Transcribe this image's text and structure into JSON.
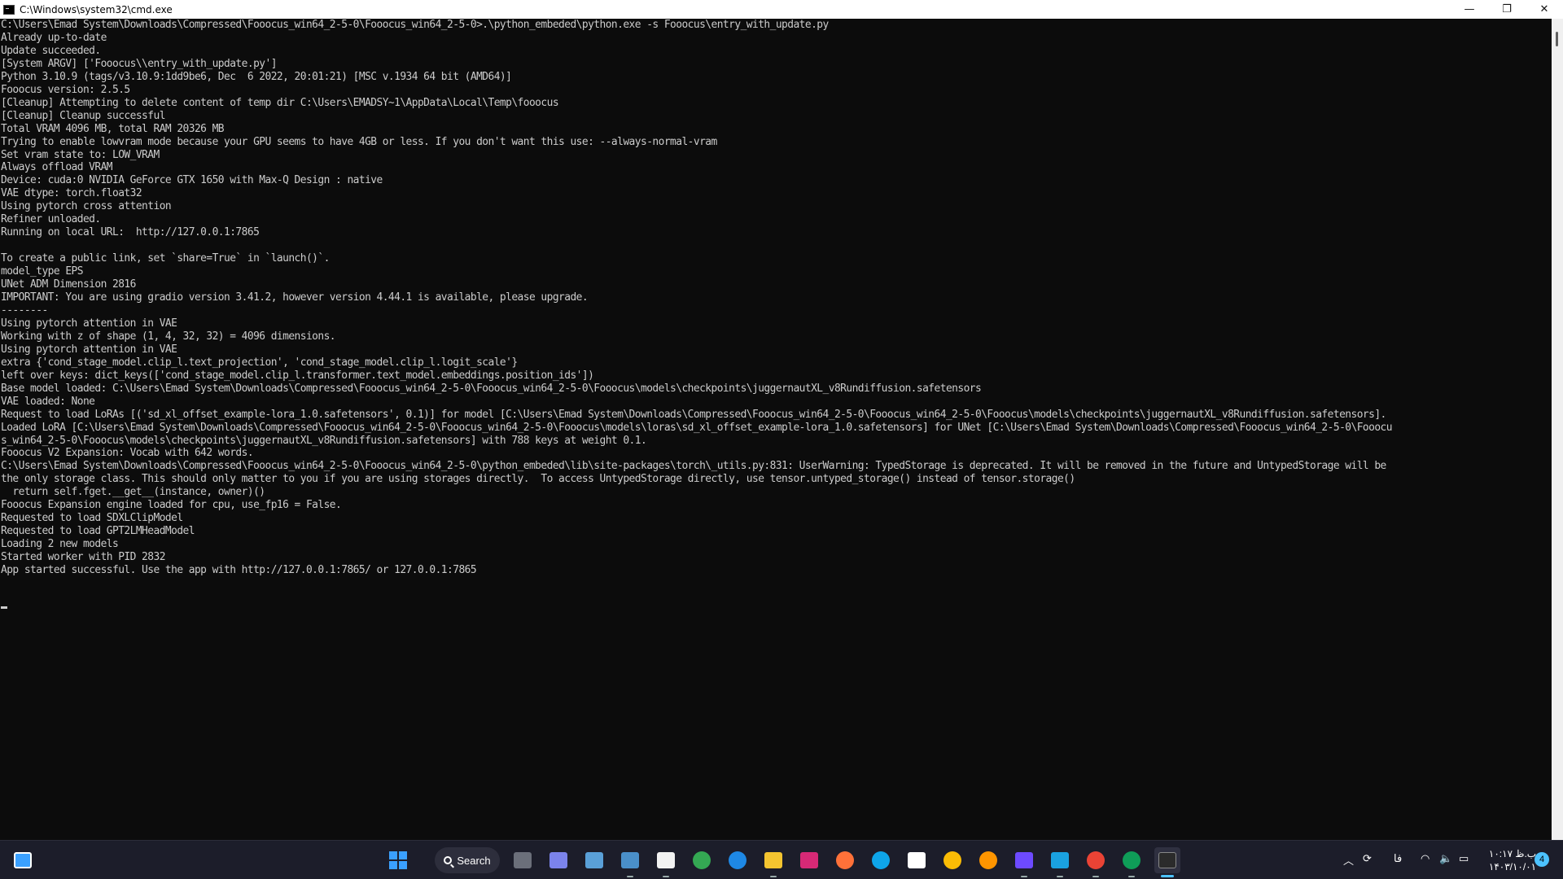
{
  "window": {
    "title": "C:\\Windows\\system32\\cmd.exe",
    "minimize": "—",
    "maximize": "❐",
    "close": "✕"
  },
  "console": {
    "lines": [
      "C:\\Users\\Emad System\\Downloads\\Compressed\\Fooocus_win64_2-5-0\\Fooocus_win64_2-5-0>.\\python_embeded\\python.exe -s Fooocus\\entry_with_update.py",
      "Already up-to-date",
      "Update succeeded.",
      "[System ARGV] ['Fooocus\\\\entry_with_update.py']",
      "Python 3.10.9 (tags/v3.10.9:1dd9be6, Dec  6 2022, 20:01:21) [MSC v.1934 64 bit (AMD64)]",
      "Fooocus version: 2.5.5",
      "[Cleanup] Attempting to delete content of temp dir C:\\Users\\EMADSY~1\\AppData\\Local\\Temp\\fooocus",
      "[Cleanup] Cleanup successful",
      "Total VRAM 4096 MB, total RAM 20326 MB",
      "Trying to enable lowvram mode because your GPU seems to have 4GB or less. If you don't want this use: --always-normal-vram",
      "Set vram state to: LOW_VRAM",
      "Always offload VRAM",
      "Device: cuda:0 NVIDIA GeForce GTX 1650 with Max-Q Design : native",
      "VAE dtype: torch.float32",
      "Using pytorch cross attention",
      "Refiner unloaded.",
      "Running on local URL:  http://127.0.0.1:7865",
      "",
      "To create a public link, set `share=True` in `launch()`.",
      "model_type EPS",
      "UNet ADM Dimension 2816",
      "IMPORTANT: You are using gradio version 3.41.2, however version 4.44.1 is available, please upgrade.",
      "--------",
      "Using pytorch attention in VAE",
      "Working with z of shape (1, 4, 32, 32) = 4096 dimensions.",
      "Using pytorch attention in VAE",
      "extra {'cond_stage_model.clip_l.text_projection', 'cond_stage_model.clip_l.logit_scale'}",
      "left over keys: dict_keys(['cond_stage_model.clip_l.transformer.text_model.embeddings.position_ids'])",
      "Base model loaded: C:\\Users\\Emad System\\Downloads\\Compressed\\Fooocus_win64_2-5-0\\Fooocus_win64_2-5-0\\Fooocus\\models\\checkpoints\\juggernautXL_v8Rundiffusion.safetensors",
      "VAE loaded: None",
      "Request to load LoRAs [('sd_xl_offset_example-lora_1.0.safetensors', 0.1)] for model [C:\\Users\\Emad System\\Downloads\\Compressed\\Fooocus_win64_2-5-0\\Fooocus_win64_2-5-0\\Fooocus\\models\\checkpoints\\juggernautXL_v8Rundiffusion.safetensors].",
      "Loaded LoRA [C:\\Users\\Emad System\\Downloads\\Compressed\\Fooocus_win64_2-5-0\\Fooocus_win64_2-5-0\\Fooocus\\models\\loras\\sd_xl_offset_example-lora_1.0.safetensors] for UNet [C:\\Users\\Emad System\\Downloads\\Compressed\\Fooocus_win64_2-5-0\\Fooocu",
      "s_win64_2-5-0\\Fooocus\\models\\checkpoints\\juggernautXL_v8Rundiffusion.safetensors] with 788 keys at weight 0.1.",
      "Fooocus V2 Expansion: Vocab with 642 words.",
      "C:\\Users\\Emad System\\Downloads\\Compressed\\Fooocus_win64_2-5-0\\Fooocus_win64_2-5-0\\python_embeded\\lib\\site-packages\\torch\\_utils.py:831: UserWarning: TypedStorage is deprecated. It will be removed in the future and UntypedStorage will be",
      "the only storage class. This should only matter to you if you are using storages directly.  To access UntypedStorage directly, use tensor.untyped_storage() instead of tensor.storage()",
      "  return self.fget.__get__(instance, owner)()",
      "Fooocus Expansion engine loaded for cpu, use_fp16 = False.",
      "Requested to load SDXLClipModel",
      "Requested to load GPT2LMHeadModel",
      "Loading 2 new models",
      "Started worker with PID 2832",
      "App started successful. Use the app with http://127.0.0.1:7865/ or 127.0.0.1:7865"
    ]
  },
  "taskbar": {
    "search_label": "Search",
    "apps": [
      {
        "name": "task-view",
        "color": "#6b6f7a"
      },
      {
        "name": "teams",
        "color": "#7b83eb"
      },
      {
        "name": "control-panel",
        "color": "#5aa0d8"
      },
      {
        "name": "task-manager",
        "color": "#4a8fc9"
      },
      {
        "name": "store",
        "color": "#f2f2f2"
      },
      {
        "name": "chrome",
        "color": "#34a853"
      },
      {
        "name": "app-blue",
        "color": "#1e88e5"
      },
      {
        "name": "file-explorer",
        "color": "#f4c430"
      },
      {
        "name": "instagram",
        "color": "#d62976"
      },
      {
        "name": "firefox",
        "color": "#ff7139"
      },
      {
        "name": "edge",
        "color": "#0ea5e9"
      },
      {
        "name": "notepad",
        "color": "#ffffff"
      },
      {
        "name": "chrome-2",
        "color": "#fbbc05"
      },
      {
        "name": "firefox-2",
        "color": "#ff9500"
      },
      {
        "name": "proton-vpn",
        "color": "#6d4aff"
      },
      {
        "name": "app-v",
        "color": "#1aa1e0"
      },
      {
        "name": "chrome-3",
        "color": "#ea4335"
      },
      {
        "name": "chrome-4",
        "color": "#0f9d58"
      },
      {
        "name": "terminal",
        "color": "#2b2b2b"
      }
    ],
    "tray": {
      "lang": "فا",
      "time": "۱۰:۱۷ ب.ظ",
      "date": "۱۴۰۳/۱۰/۰۱",
      "notifications": "4"
    }
  }
}
